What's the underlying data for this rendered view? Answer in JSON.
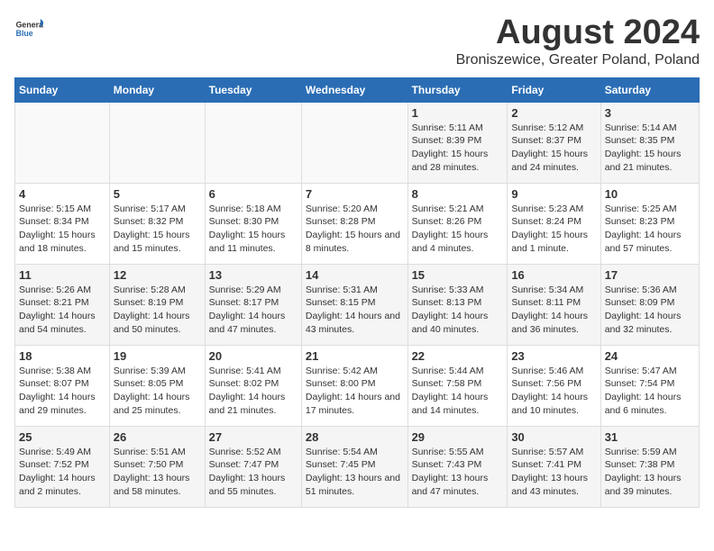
{
  "logo": {
    "general": "General",
    "blue": "Blue"
  },
  "title": "August 2024",
  "subtitle": "Broniszewice, Greater Poland, Poland",
  "days_of_week": [
    "Sunday",
    "Monday",
    "Tuesday",
    "Wednesday",
    "Thursday",
    "Friday",
    "Saturday"
  ],
  "weeks": [
    [
      {
        "day": "",
        "info": ""
      },
      {
        "day": "",
        "info": ""
      },
      {
        "day": "",
        "info": ""
      },
      {
        "day": "",
        "info": ""
      },
      {
        "day": "1",
        "info": "Sunrise: 5:11 AM\nSunset: 8:39 PM\nDaylight: 15 hours and 28 minutes."
      },
      {
        "day": "2",
        "info": "Sunrise: 5:12 AM\nSunset: 8:37 PM\nDaylight: 15 hours and 24 minutes."
      },
      {
        "day": "3",
        "info": "Sunrise: 5:14 AM\nSunset: 8:35 PM\nDaylight: 15 hours and 21 minutes."
      }
    ],
    [
      {
        "day": "4",
        "info": "Sunrise: 5:15 AM\nSunset: 8:34 PM\nDaylight: 15 hours and 18 minutes."
      },
      {
        "day": "5",
        "info": "Sunrise: 5:17 AM\nSunset: 8:32 PM\nDaylight: 15 hours and 15 minutes."
      },
      {
        "day": "6",
        "info": "Sunrise: 5:18 AM\nSunset: 8:30 PM\nDaylight: 15 hours and 11 minutes."
      },
      {
        "day": "7",
        "info": "Sunrise: 5:20 AM\nSunset: 8:28 PM\nDaylight: 15 hours and 8 minutes."
      },
      {
        "day": "8",
        "info": "Sunrise: 5:21 AM\nSunset: 8:26 PM\nDaylight: 15 hours and 4 minutes."
      },
      {
        "day": "9",
        "info": "Sunrise: 5:23 AM\nSunset: 8:24 PM\nDaylight: 15 hours and 1 minute."
      },
      {
        "day": "10",
        "info": "Sunrise: 5:25 AM\nSunset: 8:23 PM\nDaylight: 14 hours and 57 minutes."
      }
    ],
    [
      {
        "day": "11",
        "info": "Sunrise: 5:26 AM\nSunset: 8:21 PM\nDaylight: 14 hours and 54 minutes."
      },
      {
        "day": "12",
        "info": "Sunrise: 5:28 AM\nSunset: 8:19 PM\nDaylight: 14 hours and 50 minutes."
      },
      {
        "day": "13",
        "info": "Sunrise: 5:29 AM\nSunset: 8:17 PM\nDaylight: 14 hours and 47 minutes."
      },
      {
        "day": "14",
        "info": "Sunrise: 5:31 AM\nSunset: 8:15 PM\nDaylight: 14 hours and 43 minutes."
      },
      {
        "day": "15",
        "info": "Sunrise: 5:33 AM\nSunset: 8:13 PM\nDaylight: 14 hours and 40 minutes."
      },
      {
        "day": "16",
        "info": "Sunrise: 5:34 AM\nSunset: 8:11 PM\nDaylight: 14 hours and 36 minutes."
      },
      {
        "day": "17",
        "info": "Sunrise: 5:36 AM\nSunset: 8:09 PM\nDaylight: 14 hours and 32 minutes."
      }
    ],
    [
      {
        "day": "18",
        "info": "Sunrise: 5:38 AM\nSunset: 8:07 PM\nDaylight: 14 hours and 29 minutes."
      },
      {
        "day": "19",
        "info": "Sunrise: 5:39 AM\nSunset: 8:05 PM\nDaylight: 14 hours and 25 minutes."
      },
      {
        "day": "20",
        "info": "Sunrise: 5:41 AM\nSunset: 8:02 PM\nDaylight: 14 hours and 21 minutes."
      },
      {
        "day": "21",
        "info": "Sunrise: 5:42 AM\nSunset: 8:00 PM\nDaylight: 14 hours and 17 minutes."
      },
      {
        "day": "22",
        "info": "Sunrise: 5:44 AM\nSunset: 7:58 PM\nDaylight: 14 hours and 14 minutes."
      },
      {
        "day": "23",
        "info": "Sunrise: 5:46 AM\nSunset: 7:56 PM\nDaylight: 14 hours and 10 minutes."
      },
      {
        "day": "24",
        "info": "Sunrise: 5:47 AM\nSunset: 7:54 PM\nDaylight: 14 hours and 6 minutes."
      }
    ],
    [
      {
        "day": "25",
        "info": "Sunrise: 5:49 AM\nSunset: 7:52 PM\nDaylight: 14 hours and 2 minutes."
      },
      {
        "day": "26",
        "info": "Sunrise: 5:51 AM\nSunset: 7:50 PM\nDaylight: 13 hours and 58 minutes."
      },
      {
        "day": "27",
        "info": "Sunrise: 5:52 AM\nSunset: 7:47 PM\nDaylight: 13 hours and 55 minutes."
      },
      {
        "day": "28",
        "info": "Sunrise: 5:54 AM\nSunset: 7:45 PM\nDaylight: 13 hours and 51 minutes."
      },
      {
        "day": "29",
        "info": "Sunrise: 5:55 AM\nSunset: 7:43 PM\nDaylight: 13 hours and 47 minutes."
      },
      {
        "day": "30",
        "info": "Sunrise: 5:57 AM\nSunset: 7:41 PM\nDaylight: 13 hours and 43 minutes."
      },
      {
        "day": "31",
        "info": "Sunrise: 5:59 AM\nSunset: 7:38 PM\nDaylight: 13 hours and 39 minutes."
      }
    ]
  ]
}
